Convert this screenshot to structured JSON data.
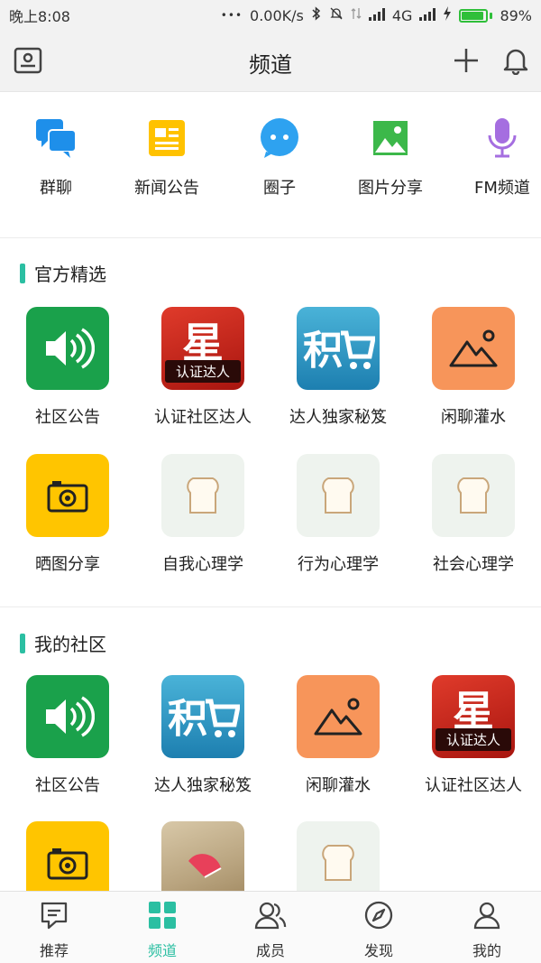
{
  "status": {
    "time": "晚上8:08",
    "dots": "•••",
    "speed": "0.00K/s",
    "network": "4G",
    "battery": "89%",
    "battery_level": 0.89
  },
  "header": {
    "title": "频道"
  },
  "quick_links": [
    {
      "label": "群聊",
      "icon": "chat-bubbles-icon"
    },
    {
      "label": "新闻公告",
      "icon": "news-icon"
    },
    {
      "label": "圈子",
      "icon": "circle-chat-icon"
    },
    {
      "label": "图片分享",
      "icon": "picture-icon"
    },
    {
      "label": "FM频道",
      "icon": "microphone-icon"
    }
  ],
  "official": {
    "title": "官方精选",
    "items": [
      {
        "label": "社区公告",
        "icon": "speaker-icon"
      },
      {
        "label": "认证社区达人",
        "icon": "star-badge-icon",
        "badge": "星",
        "sub": "认证达人"
      },
      {
        "label": "达人独家秘笈",
        "icon": "cart-logo-icon",
        "badge": "积"
      },
      {
        "label": "闲聊灌水",
        "icon": "mountain-icon"
      },
      {
        "label": "晒图分享",
        "icon": "camera-icon"
      },
      {
        "label": "自我心理学",
        "icon": "bread-icon"
      },
      {
        "label": "行为心理学",
        "icon": "bread-icon"
      },
      {
        "label": "社会心理学",
        "icon": "bread-icon"
      }
    ]
  },
  "mine": {
    "title": "我的社区",
    "items": [
      {
        "label": "社区公告",
        "icon": "speaker-icon"
      },
      {
        "label": "达人独家秘笈",
        "icon": "cart-logo-icon",
        "badge": "积"
      },
      {
        "label": "闲聊灌水",
        "icon": "mountain-icon"
      },
      {
        "label": "认证社区达人",
        "icon": "star-badge-icon",
        "badge": "星",
        "sub": "认证达人"
      },
      {
        "label": "",
        "icon": "camera-icon"
      },
      {
        "label": "",
        "icon": "photo-thumbnail"
      },
      {
        "label": "",
        "icon": "bread-icon"
      }
    ]
  },
  "tabs": [
    {
      "label": "推荐",
      "icon": "recommend-icon"
    },
    {
      "label": "频道",
      "icon": "grid-icon",
      "active": true
    },
    {
      "label": "成员",
      "icon": "members-icon"
    },
    {
      "label": "发现",
      "icon": "compass-icon"
    },
    {
      "label": "我的",
      "icon": "profile-icon"
    }
  ],
  "colors": {
    "accent": "#2bbfa2",
    "battery": "#2fbf3a",
    "speaker_bg": "#1aa14b",
    "camera_bg": "#ffc500",
    "mountain_bg": "#f7955a"
  }
}
